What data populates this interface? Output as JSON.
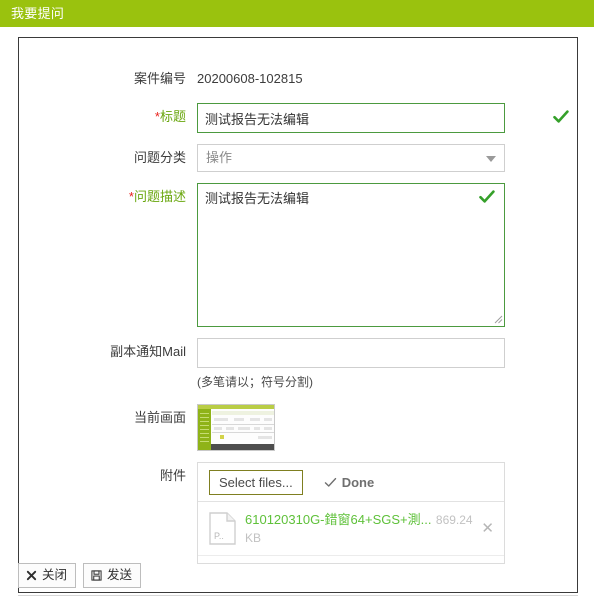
{
  "window": {
    "title": "我要提问"
  },
  "form": {
    "case_no": {
      "label": "案件编号",
      "value": "20200608-102815"
    },
    "title": {
      "label": "标题",
      "required_mark": "*",
      "value": "测试报告无法编辑",
      "placeholder": "",
      "valid_icon": "check-icon"
    },
    "category": {
      "label": "问题分类",
      "value": "操作",
      "arrow_icon": "chevron-down-icon"
    },
    "description": {
      "label": "问题描述",
      "required_mark": "*",
      "value": "测试报告无法编辑",
      "placeholder": "",
      "valid_icon": "check-icon"
    },
    "cc_mail": {
      "label": "副本通知Mail",
      "value": "",
      "placeholder": "",
      "hint": "(多笔请以；符号分割)"
    },
    "current_screen": {
      "label": "当前画面",
      "thumbnail_alt": "screenshot-thumbnail"
    },
    "attachment": {
      "label": "附件",
      "select_button": "Select files...",
      "status": "Done",
      "status_icon": "check-icon",
      "files": [
        {
          "name": "610120310G-錯窗64+SGS+測...",
          "size": "869.24 KB",
          "icon_text": "P..",
          "remove_icon": "close-icon"
        }
      ]
    }
  },
  "footer": {
    "close_button": {
      "label": "关闭",
      "icon": "close-x-icon"
    },
    "send_button": {
      "label": "发送",
      "icon": "save-floppy-icon"
    }
  },
  "colors": {
    "header_green": "#9ac20e",
    "valid_border_green": "#4c9a3f",
    "required_label_green": "#6aa70f",
    "required_star_red": "#e8231e",
    "file_name_green": "#5fc13a"
  }
}
